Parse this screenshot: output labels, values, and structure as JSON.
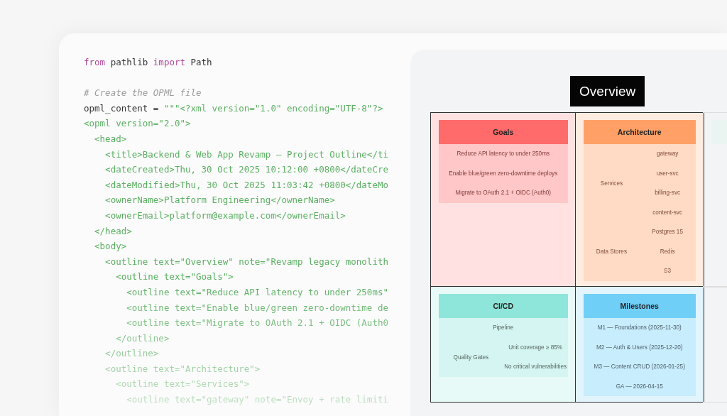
{
  "code": {
    "blocks": [
      [
        {
          "tokens": [
            {
              "kind": "keyword",
              "text": "from"
            },
            {
              "kind": "plain",
              "text": " pathlib "
            },
            {
              "kind": "keyword",
              "text": "import"
            },
            {
              "kind": "plain",
              "text": " Path"
            }
          ]
        }
      ],
      [
        {
          "tokens": [
            {
              "kind": "comment",
              "text": "# Create the OPML file"
            }
          ]
        },
        {
          "tokens": [
            {
              "kind": "plain",
              "text": "opml_content = "
            },
            {
              "kind": "string",
              "text": "\"\"\"<?xml version=\"1.0\" encoding=\"UTF-8\"?>"
            }
          ]
        },
        {
          "tokens": [
            {
              "kind": "string",
              "text": "<opml version=\"2.0\">"
            }
          ]
        },
        {
          "tokens": [
            {
              "kind": "string",
              "text": "  <head>"
            }
          ]
        },
        {
          "tokens": [
            {
              "kind": "string",
              "text": "    <title>Backend & Web App Revamp — Project Outline</ti"
            }
          ]
        },
        {
          "tokens": [
            {
              "kind": "string",
              "text": "    <dateCreated>Thu, 30 Oct 2025 10:12:00 +0800</dateCre"
            }
          ]
        },
        {
          "tokens": [
            {
              "kind": "string",
              "text": "    <dateModified>Thu, 30 Oct 2025 11:03:42 +0800</dateMo"
            }
          ]
        },
        {
          "tokens": [
            {
              "kind": "string",
              "text": "    <ownerName>Platform Engineering</ownerName>"
            }
          ]
        },
        {
          "tokens": [
            {
              "kind": "string",
              "text": "    <ownerEmail>platform@example.com</ownerEmail>"
            }
          ]
        },
        {
          "tokens": [
            {
              "kind": "string",
              "text": "  </head>"
            }
          ]
        },
        {
          "tokens": [
            {
              "kind": "string",
              "text": "  <body>"
            }
          ]
        },
        {
          "tokens": [
            {
              "kind": "string",
              "text": "    <outline text=\"Overview\" note=\"Revamp legacy monolith"
            }
          ]
        },
        {
          "tokens": [
            {
              "kind": "string",
              "text": "      <outline text=\"Goals\">"
            }
          ]
        },
        {
          "tokens": [
            {
              "kind": "string",
              "text": "        <outline text=\"Reduce API latency to under 250ms\""
            }
          ]
        },
        {
          "tokens": [
            {
              "kind": "string",
              "text": "        <outline text=\"Enable blue/green zero-downtime de"
            }
          ]
        },
        {
          "tokens": [
            {
              "kind": "string",
              "text": "        <outline text=\"Migrate to OAuth 2.1 + OIDC (Auth0"
            }
          ]
        },
        {
          "tokens": [
            {
              "kind": "string",
              "text": "      </outline>"
            }
          ]
        },
        {
          "tokens": [
            {
              "kind": "string",
              "text": "    </outline>"
            }
          ]
        },
        {
          "tokens": [
            {
              "kind": "string",
              "text": "    <outline text=\"Architecture\">"
            }
          ]
        },
        {
          "tokens": [
            {
              "kind": "string",
              "text": "      <outline text=\"Services\">"
            }
          ]
        },
        {
          "tokens": [
            {
              "kind": "string",
              "text": "        <outline text=\"gateway\" note=\"Envoy + rate limiti"
            }
          ]
        }
      ]
    ]
  },
  "map": {
    "title": "Overview",
    "branches": [
      {
        "title": "Goals",
        "color": "#ff6b6b",
        "children": [
          {
            "text": "Reduce API latency to under 250ms"
          },
          {
            "text": "Enable blue/green zero-downtime deploys"
          },
          {
            "text": "Migrate to OAuth 2.1 + OIDC (Auth0)"
          }
        ]
      },
      {
        "title": "Architecture",
        "color": "#ffa066",
        "children": [
          {
            "text": "Services",
            "children": [
              {
                "text": "gateway"
              },
              {
                "text": "user-svc"
              },
              {
                "text": "billing-svc"
              },
              {
                "text": "content-svc"
              }
            ]
          },
          {
            "text": "Data Stores",
            "children": [
              {
                "text": "Postgres 15"
              },
              {
                "text": "Redis"
              },
              {
                "text": "S3"
              }
            ]
          }
        ]
      },
      {
        "title": "CI/CD",
        "color": "#8ee5d9",
        "children": [
          {
            "text": "Pipeline"
          },
          {
            "text": "Quality Gates",
            "children": [
              {
                "text": "Unit coverage ≥ 85%"
              },
              {
                "text": "No critical vulnerabilities"
              }
            ]
          }
        ]
      },
      {
        "title": "Milestones",
        "color": "#6fcff7",
        "children": [
          {
            "text": "M1 — Foundations (2025-11-30)"
          },
          {
            "text": "M2 — Auth & Users (2025-12-20)"
          },
          {
            "text": "M3 — Content CRUD (2026-01-25)"
          },
          {
            "text": "GA — 2026-04-15"
          }
        ]
      }
    ]
  }
}
